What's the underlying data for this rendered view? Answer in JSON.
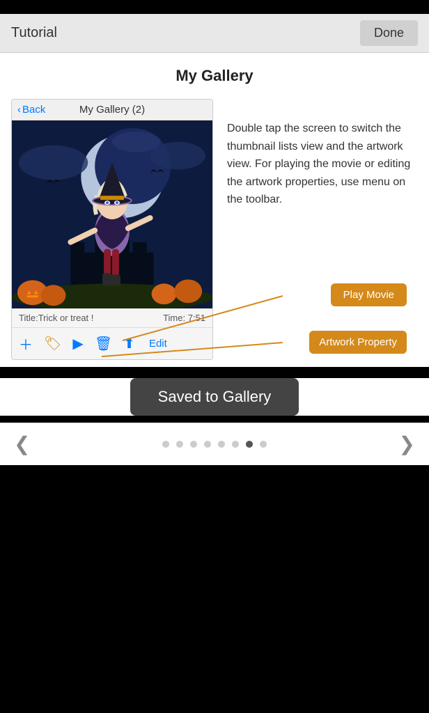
{
  "nav": {
    "title": "Tutorial",
    "done_label": "Done"
  },
  "page": {
    "title": "My Gallery"
  },
  "phone": {
    "back_label": "Back",
    "gallery_title": "My Gallery (2)",
    "artwork_title": "Title:Trick or treat !",
    "artwork_time": "Time: 7:51"
  },
  "description": "Double tap the screen to switch the thumbnail lists view and the artwork view. For playing the movie or editing the artwork properties, use menu on the toolbar.",
  "callouts": {
    "play_movie": "Play Movie",
    "artwork_property": "Artwork Property"
  },
  "saved": {
    "label": "Saved to Gallery"
  },
  "pagination": {
    "total_dots": 8,
    "active_dot": 7
  },
  "toolbar": {
    "icons": [
      "＋",
      "🏷",
      "▶",
      "🗑",
      "⬆",
      "Edit"
    ]
  }
}
